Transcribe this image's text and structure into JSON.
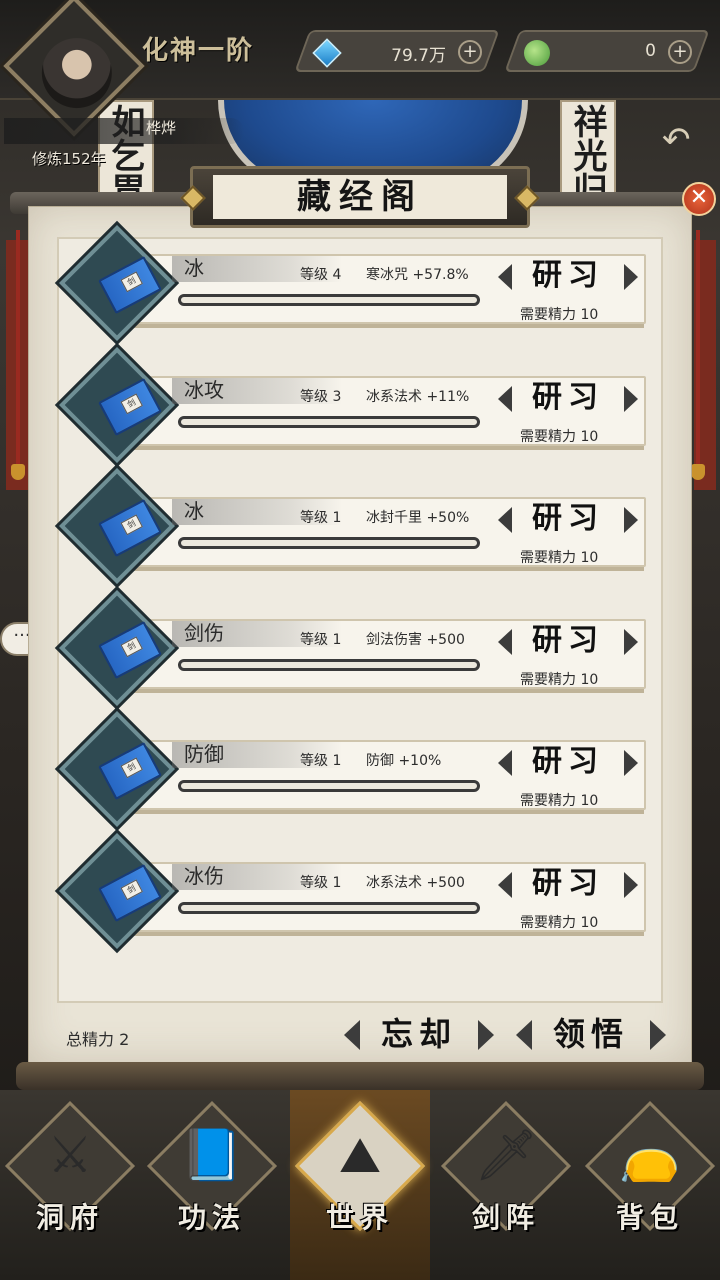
{
  "hud": {
    "realm": "化神一阶",
    "player_name": "桦烨",
    "cultivation_years": "修炼152年",
    "spirit_stones": "79.7万",
    "jade": "0",
    "plus": "+"
  },
  "background": {
    "couplet_left": "如乞胃",
    "couplet_right": "祥光归"
  },
  "panel": {
    "title": "藏经阁",
    "close_symbol": "✕",
    "rows": [
      {
        "name": "冰",
        "level": "等级 4",
        "effect": "寒冰咒 +57.8%",
        "button": "研习",
        "cost": "需要精力 10",
        "progress": 0
      },
      {
        "name": "冰攻",
        "level": "等级 3",
        "effect": "冰系法术 +11%",
        "button": "研习",
        "cost": "需要精力 10",
        "progress": 0
      },
      {
        "name": "冰",
        "level": "等级 1",
        "effect": "冰封千里 +50%",
        "button": "研习",
        "cost": "需要精力 10",
        "progress": 0
      },
      {
        "name": "剑伤",
        "level": "等级 1",
        "effect": "剑法伤害 +500",
        "button": "研习",
        "cost": "需要精力 10",
        "progress": 0
      },
      {
        "name": "防御",
        "level": "等级 1",
        "effect": "防御 +10%",
        "button": "研习",
        "cost": "需要精力 10",
        "progress": 0
      },
      {
        "name": "冰伤",
        "level": "等级 1",
        "effect": "冰系法术 +500",
        "button": "研习",
        "cost": "需要精力 10",
        "progress": 0
      }
    ],
    "total_energy": "总精力 2",
    "forget_label": "忘却",
    "comprehend_label": "领悟"
  },
  "nav": {
    "items": [
      {
        "label": "洞府",
        "icon": "general-statue-icon"
      },
      {
        "label": "功法",
        "icon": "scroll-books-icon"
      },
      {
        "label": "世界",
        "icon": "mountain-crest-icon"
      },
      {
        "label": "剑阵",
        "icon": "crossed-swords-icon"
      },
      {
        "label": "背包",
        "icon": "treasure-bag-icon"
      }
    ],
    "active_index": 2
  },
  "colors": {
    "paper": "#e9e4d6",
    "book_blue": "#2767c4",
    "badge_teal": "#2f4a52",
    "active_nav": "#d8a94b"
  }
}
